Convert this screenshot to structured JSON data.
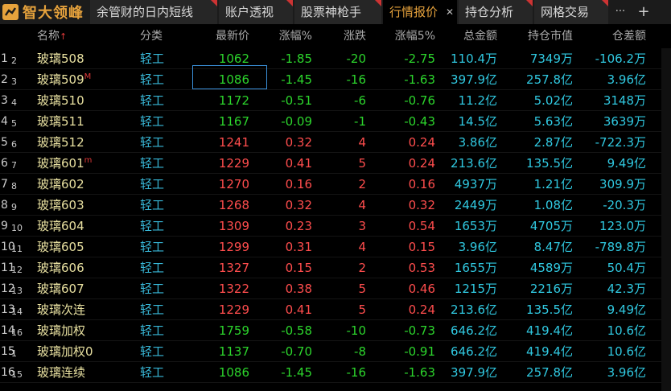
{
  "app": {
    "logo_text": "智大领峰",
    "brand_color": "#e6a23c"
  },
  "tabs": [
    {
      "label": "余管财的日内短线",
      "active": false
    },
    {
      "label": "账户透视",
      "active": false
    },
    {
      "label": "股票神枪手",
      "active": false
    },
    {
      "label": "行情报价",
      "active": true
    },
    {
      "label": "持仓分析",
      "active": false
    },
    {
      "label": "网格交易",
      "active": false
    }
  ],
  "toolbar": {
    "more_icon": "more-icon",
    "more_glyph": "···",
    "add_icon": "plus-icon",
    "add_glyph": "+"
  },
  "columns": {
    "name": "名称",
    "name_sort_glyph": "↑",
    "category": "分类",
    "latest": "最新价",
    "change_pct": "涨幅%",
    "change": "涨跌",
    "change_pct_5": "涨幅5%",
    "amount": "总金额",
    "holding_value": "持仓市值",
    "position_diff": "仓差额"
  },
  "rows": [
    {
      "num": "1",
      "sub": "2",
      "name": "玻璃508",
      "mark": "",
      "cat": "轻工",
      "price": "1062",
      "pct": "-1.85",
      "chg": "-20",
      "pct5": "-2.75",
      "amount": "110.4万",
      "hold": "7349万",
      "diff": "-106.2万",
      "dir": "down"
    },
    {
      "num": "2",
      "sub": "3",
      "name": "玻璃509",
      "mark": "M",
      "cat": "轻工",
      "price": "1086",
      "pct": "-1.45",
      "chg": "-16",
      "pct5": "-1.63",
      "amount": "397.9亿",
      "hold": "257.8亿",
      "diff": "3.96亿",
      "dir": "down"
    },
    {
      "num": "3",
      "sub": "4",
      "name": "玻璃510",
      "mark": "",
      "cat": "轻工",
      "price": "1172",
      "pct": "-0.51",
      "chg": "-6",
      "pct5": "-0.76",
      "amount": "11.2亿",
      "hold": "5.02亿",
      "diff": "3148万",
      "dir": "down"
    },
    {
      "num": "4",
      "sub": "5",
      "name": "玻璃511",
      "mark": "",
      "cat": "轻工",
      "price": "1167",
      "pct": "-0.09",
      "chg": "-1",
      "pct5": "-0.43",
      "amount": "14.5亿",
      "hold": "5.63亿",
      "diff": "3639万",
      "dir": "down"
    },
    {
      "num": "5",
      "sub": "6",
      "name": "玻璃512",
      "mark": "",
      "cat": "轻工",
      "price": "1241",
      "pct": "0.32",
      "chg": "4",
      "pct5": "0.24",
      "amount": "3.86亿",
      "hold": "2.87亿",
      "diff": "-722.3万",
      "dir": "up"
    },
    {
      "num": "6",
      "sub": "7",
      "name": "玻璃601",
      "mark": "m",
      "cat": "轻工",
      "price": "1229",
      "pct": "0.41",
      "chg": "5",
      "pct5": "0.24",
      "amount": "213.6亿",
      "hold": "135.5亿",
      "diff": "9.49亿",
      "dir": "up"
    },
    {
      "num": "7",
      "sub": "8",
      "name": "玻璃602",
      "mark": "",
      "cat": "轻工",
      "price": "1270",
      "pct": "0.16",
      "chg": "2",
      "pct5": "0.16",
      "amount": "4937万",
      "hold": "1.21亿",
      "diff": "309.9万",
      "dir": "up"
    },
    {
      "num": "8",
      "sub": "9",
      "name": "玻璃603",
      "mark": "",
      "cat": "轻工",
      "price": "1268",
      "pct": "0.32",
      "chg": "4",
      "pct5": "0.32",
      "amount": "2449万",
      "hold": "1.08亿",
      "diff": "-20.3万",
      "dir": "up"
    },
    {
      "num": "9",
      "sub": "10",
      "name": "玻璃604",
      "mark": "",
      "cat": "轻工",
      "price": "1309",
      "pct": "0.23",
      "chg": "3",
      "pct5": "0.54",
      "amount": "1653万",
      "hold": "4705万",
      "diff": "123.0万",
      "dir": "up"
    },
    {
      "num": "10",
      "sub": "11",
      "name": "玻璃605",
      "mark": "",
      "cat": "轻工",
      "price": "1299",
      "pct": "0.31",
      "chg": "4",
      "pct5": "0.15",
      "amount": "3.96亿",
      "hold": "8.47亿",
      "diff": "-789.8万",
      "dir": "up"
    },
    {
      "num": "11",
      "sub": "12",
      "name": "玻璃606",
      "mark": "",
      "cat": "轻工",
      "price": "1327",
      "pct": "0.15",
      "chg": "2",
      "pct5": "0.53",
      "amount": "1655万",
      "hold": "4589万",
      "diff": "50.4万",
      "dir": "up"
    },
    {
      "num": "12",
      "sub": "13",
      "name": "玻璃607",
      "mark": "",
      "cat": "轻工",
      "price": "1322",
      "pct": "0.38",
      "chg": "5",
      "pct5": "0.46",
      "amount": "1215万",
      "hold": "2216万",
      "diff": "42.3万",
      "dir": "up"
    },
    {
      "num": "13",
      "sub": "14",
      "name": "玻璃次连",
      "mark": "",
      "cat": "轻工",
      "price": "1229",
      "pct": "0.41",
      "chg": "5",
      "pct5": "0.24",
      "amount": "213.6亿",
      "hold": "135.5亿",
      "diff": "9.49亿",
      "dir": "up"
    },
    {
      "num": "14",
      "sub": "16",
      "name": "玻璃加权",
      "mark": "",
      "cat": "轻工",
      "price": "1759",
      "pct": "-0.58",
      "chg": "-10",
      "pct5": "-0.73",
      "amount": "646.2亿",
      "hold": "419.4亿",
      "diff": "10.6亿",
      "dir": "down"
    },
    {
      "num": "15",
      "sub": "1",
      "name": "玻璃加权0",
      "mark": "",
      "cat": "轻工",
      "price": "1137",
      "pct": "-0.70",
      "chg": "-8",
      "pct5": "-0.91",
      "amount": "646.2亿",
      "hold": "419.4亿",
      "diff": "10.6亿",
      "dir": "down"
    },
    {
      "num": "16",
      "sub": "15",
      "name": "玻璃连续",
      "mark": "",
      "cat": "轻工",
      "price": "1086",
      "pct": "-1.45",
      "chg": "-16",
      "pct5": "-1.63",
      "amount": "397.9亿",
      "hold": "257.8亿",
      "diff": "3.96亿",
      "dir": "down"
    }
  ],
  "colors": {
    "up": "#ff4d4d",
    "down": "#2cd52c",
    "accent": "#e6a23c",
    "value": "#30c8e0",
    "category": "#38b8d8"
  }
}
